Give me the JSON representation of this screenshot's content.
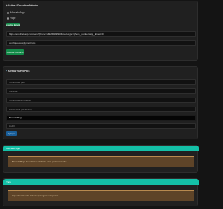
{
  "actions": {
    "title": "⚙ Activar / Desactivar Métodos",
    "options": [
      {
        "label": "MercadoPago",
        "selected": false
      },
      {
        "label": "Yape",
        "selected": false
      }
    ],
    "save_label": "Guardar Estado",
    "whatsapp_link_value": "https://api.whatsapp.com/send?phone=5492009999944&text&type=phone_number&app_absent=0",
    "email_value": "xxxxfigurexxxx@gmail.com",
    "save_contact_label": "Guardar Contacto"
  },
  "add_pack": {
    "title": "Agregar Nuevo Pack",
    "title_icon": "plus-icon",
    "fields": [
      {
        "name": "country-field",
        "placeholder": "Nombre del país",
        "value": ""
      },
      {
        "name": "quantity-field",
        "placeholder": "Cantidad",
        "value": ""
      },
      {
        "name": "currency-field",
        "placeholder": "Nombre de la moneda",
        "value": ""
      },
      {
        "name": "price-field",
        "placeholder": "Precio local (ARS/PEN)",
        "value": ""
      },
      {
        "name": "method-select",
        "placeholder": "",
        "value": "MercadoPago"
      },
      {
        "name": "usd-field",
        "placeholder": "",
        "value": "Lo4/Ol"
      }
    ],
    "add_label": "Agregar"
  },
  "methods": [
    {
      "name": "MercadoPago",
      "status": "MercadoPago desactivado. Activalo para gestionar packs."
    },
    {
      "name": "Yape",
      "status": "Yape desactivado. Activalo para gestionar packs."
    }
  ],
  "colors": {
    "accent_teal": "#14c0a7",
    "button_green": "#138b49",
    "button_blue": "#1a5f9a",
    "warning_bg": "#5e4428",
    "warning_border": "#b88a4f"
  }
}
